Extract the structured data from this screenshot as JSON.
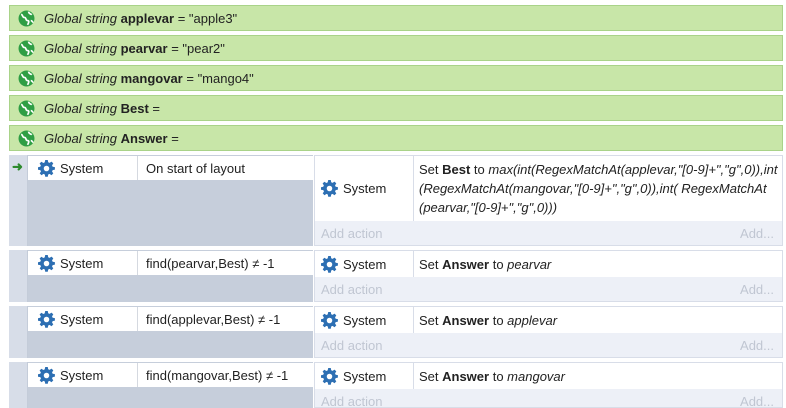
{
  "globals": [
    {
      "kw": "Global string",
      "name": "applevar",
      "rest": " = \"apple3\""
    },
    {
      "kw": "Global string",
      "name": "pearvar",
      "rest": " = \"pear2\""
    },
    {
      "kw": "Global string",
      "name": "mangovar",
      "rest": " = \"mango4\""
    },
    {
      "kw": "Global string",
      "name": "Best",
      "rest": " ="
    },
    {
      "kw": "Global string",
      "name": "Answer",
      "rest": " ="
    }
  ],
  "events": [
    {
      "cond_object": "System",
      "cond_text": "On start of layout",
      "act_object": "System",
      "act_prefix": "Set ",
      "act_var": "Best",
      "act_mid": " to ",
      "act_expr": "max(int(RegexMatchAt(applevar,\"[0-9]+\",\"g\",0)),int(RegexMatchAt(mangovar,\"[0-9]+\",\"g\",0)),int( RegexMatchAt(pearvar,\"[0-9]+\",\"g\",0)))"
    },
    {
      "cond_object": "System",
      "cond_text": "find(pearvar,Best) ≠ -1",
      "act_object": "System",
      "act_prefix": "Set ",
      "act_var": "Answer",
      "act_mid": " to ",
      "act_expr": "pearvar"
    },
    {
      "cond_object": "System",
      "cond_text": "find(applevar,Best) ≠ -1",
      "act_object": "System",
      "act_prefix": "Set ",
      "act_var": "Answer",
      "act_mid": " to ",
      "act_expr": "applevar"
    },
    {
      "cond_object": "System",
      "cond_text": "find(mangovar,Best) ≠ -1",
      "act_object": "System",
      "act_prefix": "Set ",
      "act_var": "Answer",
      "act_mid": " to ",
      "act_expr": "mangovar"
    }
  ],
  "labels": {
    "add_action": "Add action",
    "add_dots": "Add..."
  },
  "icons": {
    "global": "globe-icon",
    "system": "gear-icon",
    "trigger": "arrow-right-icon"
  },
  "colors": {
    "global_bg": "#c8e6a8",
    "globe": "#2e9e44",
    "gear": "#2d6fb3"
  }
}
